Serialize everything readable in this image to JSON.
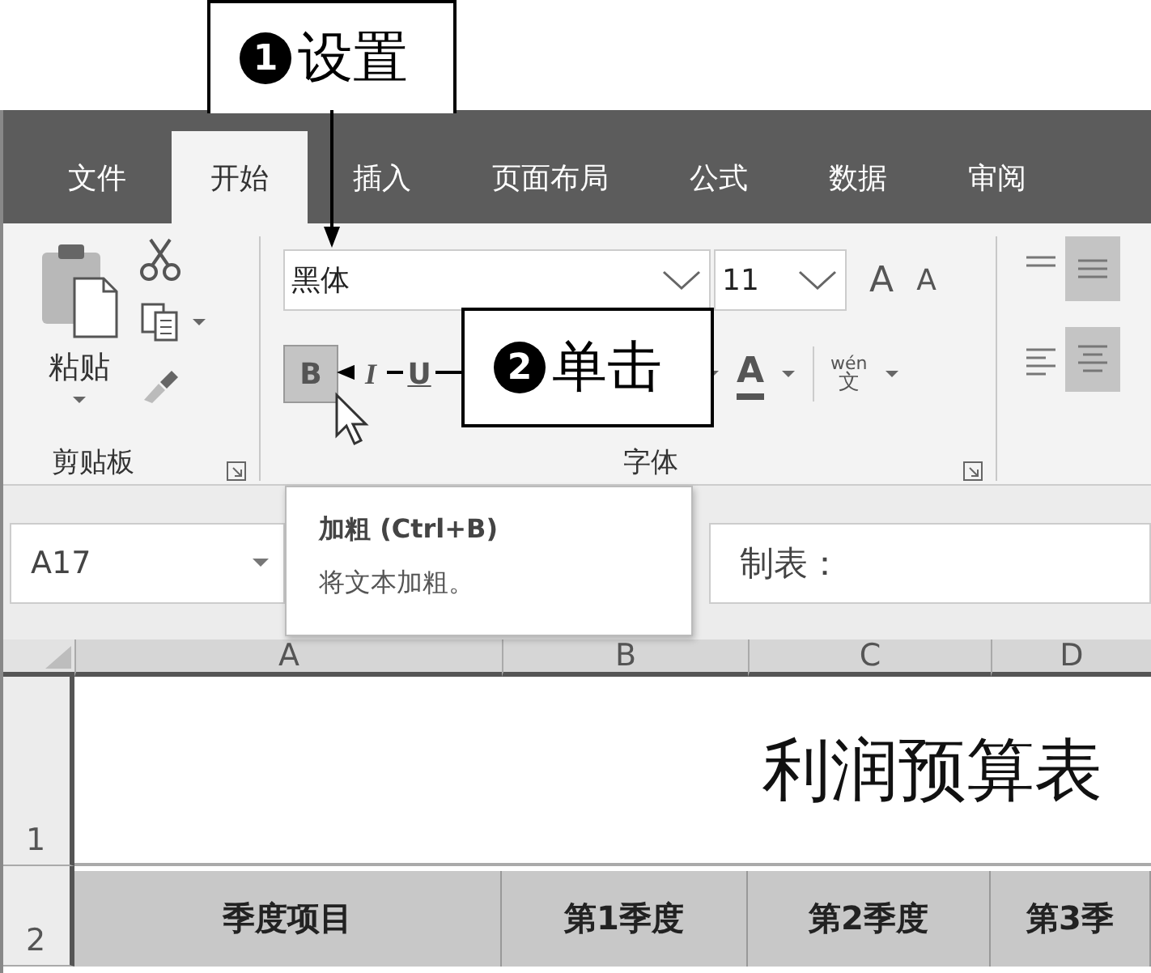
{
  "callouts": [
    {
      "step": "1",
      "label": "设置"
    },
    {
      "step": "2",
      "label": "单击"
    }
  ],
  "tabs": [
    {
      "label": "文件",
      "selected": false
    },
    {
      "label": "开始",
      "selected": true
    },
    {
      "label": "插入",
      "selected": false
    },
    {
      "label": "页面布局",
      "selected": false
    },
    {
      "label": "公式",
      "selected": false
    },
    {
      "label": "数据",
      "selected": false
    },
    {
      "label": "审阅",
      "selected": false
    }
  ],
  "clipboard": {
    "paste_label": "粘贴",
    "group_label": "剪贴板"
  },
  "font_group": {
    "font_name": "黑体",
    "font_size": "11",
    "grow": "A",
    "shrink": "A",
    "bold": {
      "label": "B",
      "selected": true
    },
    "italic": "I",
    "underline": "U",
    "font_color": "A",
    "phonetic_top": "wén",
    "phonetic_bottom": "文",
    "group_label": "字体"
  },
  "tooltip": {
    "title": "加粗 (Ctrl+B)",
    "description": "将文本加粗。"
  },
  "name_box": "A17",
  "formula": "制表：",
  "sheet": {
    "columns": [
      "A",
      "B",
      "C",
      "D"
    ],
    "title_row": {
      "number": "1",
      "title": "利润预算表"
    },
    "header_row": {
      "number": "2",
      "cells": [
        "季度项目",
        "第1季度",
        "第2季度",
        "第3季"
      ]
    }
  }
}
